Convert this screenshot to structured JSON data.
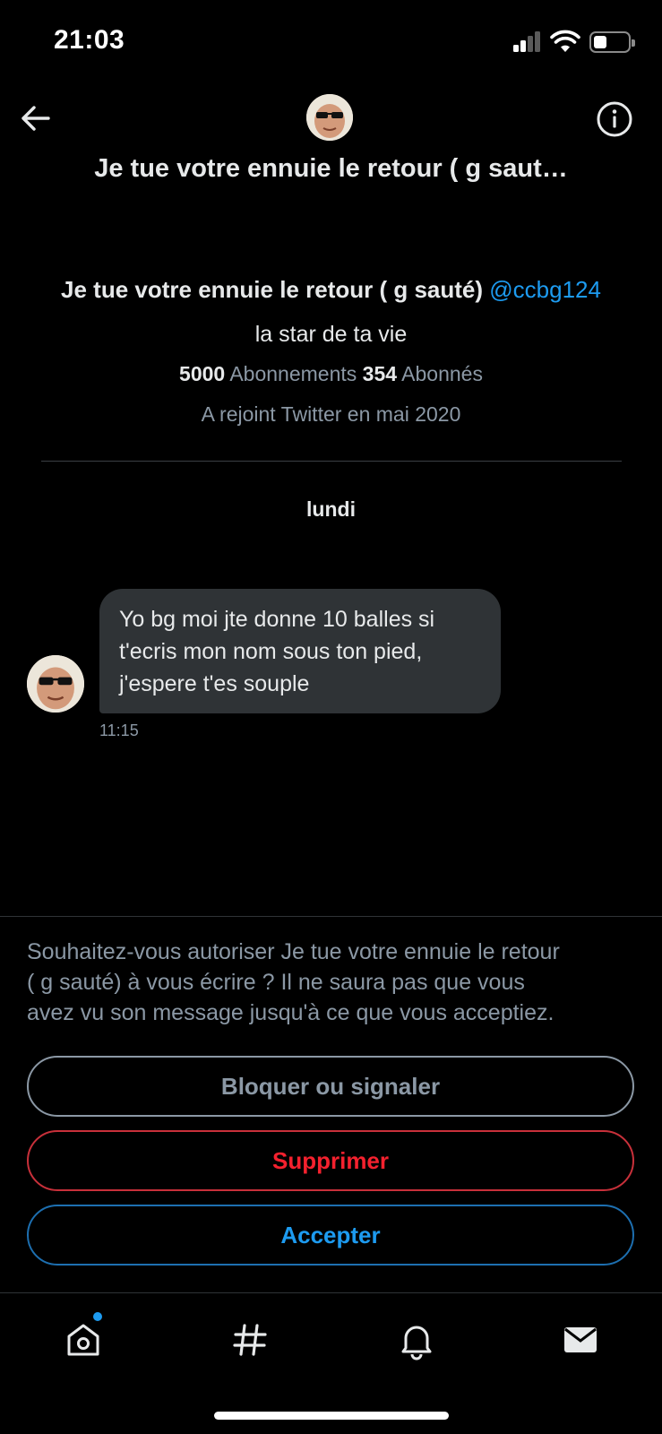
{
  "status_bar": {
    "time": "21:03"
  },
  "header": {
    "title": "Je tue votre ennuie le retour ( g saut…",
    "back_icon": "arrow-left-icon",
    "info_icon": "info-circle-icon"
  },
  "profile": {
    "name": "Je tue votre ennuie le retour ( g sauté)",
    "handle": "@ccbg124",
    "bio": "la star de ta vie",
    "following_count": "5000",
    "following_label": "Abonnements",
    "followers_count": "354",
    "followers_label": "Abonnés",
    "joined": "A rejoint Twitter en mai 2020"
  },
  "conversation": {
    "day_label": "lundi",
    "messages": [
      {
        "lines": [
          "Yo bg moi jte donne 10 balles si",
          "t'ecris mon nom sous ton pied,",
          "j'espere t'es souple"
        ],
        "time": "11:15"
      }
    ]
  },
  "request": {
    "text_lines": [
      "Souhaitez-vous autoriser Je tue votre ennuie le retour",
      "( g sauté) à vous écrire ? Il ne saura pas que vous",
      "avez vu son message jusqu'à ce que vous acceptiez."
    ],
    "block_label": "Bloquer ou signaler",
    "delete_label": "Supprimer",
    "accept_label": "Accepter"
  },
  "nav": {
    "items": [
      "home-icon",
      "explore-hashtag-icon",
      "notifications-bell-icon",
      "messages-envelope-icon"
    ]
  },
  "colors": {
    "background": "#000000",
    "accent_blue": "#1d9bf0",
    "danger_red": "#f4212e",
    "secondary_text": "#8b98a5",
    "bubble": "#2f3336"
  }
}
